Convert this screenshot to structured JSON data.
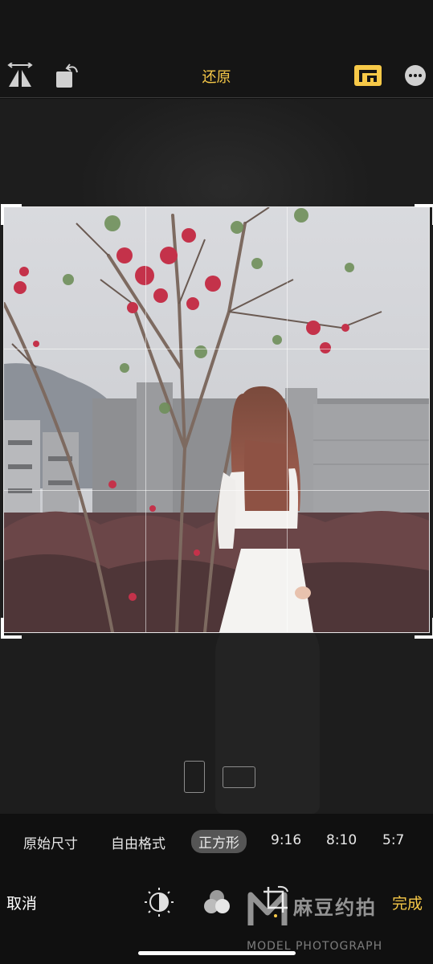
{
  "toolbar": {
    "reset_label": "还原",
    "icons": [
      "flip-horizontal-icon",
      "rotate-icon",
      "aspect-ratio-icon",
      "more-icon"
    ],
    "accent": "#f7c948"
  },
  "aspect_options": [
    "原始尺寸",
    "自由格式",
    "正方形",
    "9:16",
    "8:10",
    "5:7"
  ],
  "selected_aspect": "正方形",
  "bottom": {
    "cancel_label": "取消",
    "done_label": "完成",
    "tool_icons": [
      "adjust-icon",
      "filters-icon",
      "crop-icon"
    ]
  },
  "watermark": {
    "text": "麻豆约拍",
    "sub": "MODEL PHOTOGRAPH"
  }
}
